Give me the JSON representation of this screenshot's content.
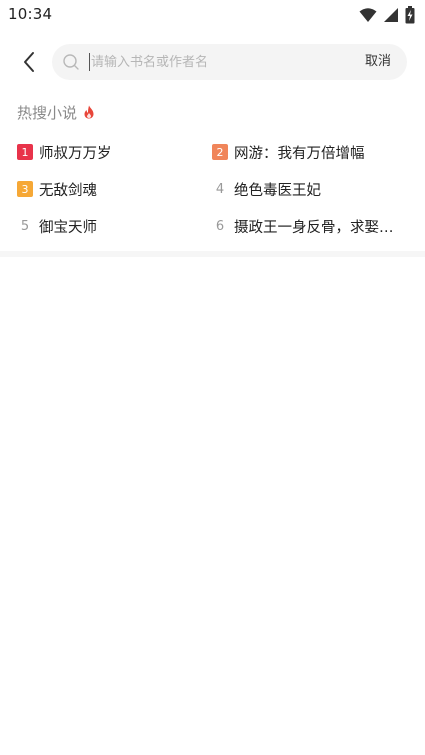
{
  "status_bar": {
    "time": "10:34",
    "icons": [
      "wifi-icon",
      "cellular-signal-icon",
      "battery-charging-icon"
    ]
  },
  "search": {
    "placeholder": "请输入书名或作者名",
    "value": "",
    "cancel_label": "取消"
  },
  "hot_search": {
    "title": "热搜小说",
    "items": [
      {
        "rank": "1",
        "label": "师叔万万岁",
        "badge_color": "#e8334a"
      },
      {
        "rank": "2",
        "label": "网游：我有万倍增幅",
        "badge_color": "#f0855a"
      },
      {
        "rank": "3",
        "label": "无敌剑魂",
        "badge_color": "#f6a836"
      },
      {
        "rank": "4",
        "label": "绝色毒医王妃",
        "badge_color": ""
      },
      {
        "rank": "5",
        "label": "御宝天师",
        "badge_color": ""
      },
      {
        "rank": "6",
        "label": "摄政王一身反骨，求娶…",
        "badge_color": ""
      }
    ]
  },
  "colors": {
    "accent_fire": "#e8463a",
    "search_bg": "#f4f4f4",
    "muted_text": "#8a8a8a"
  }
}
